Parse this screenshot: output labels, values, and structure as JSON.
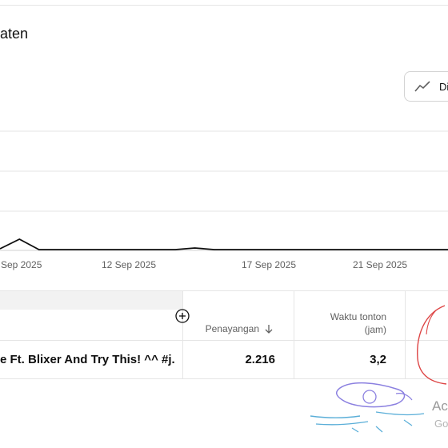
{
  "page": {
    "title": "aten"
  },
  "chart_toggle": {
    "label": "Di",
    "icon": "line-chart-icon"
  },
  "chart_data": {
    "type": "line",
    "x_tick_labels": [
      "Sep 2025",
      "12 Sep 2025",
      "17 Sep 2025",
      "21 Sep 2025"
    ],
    "series": [
      {
        "values": [
          2,
          14,
          1,
          1,
          1,
          1,
          1,
          1,
          1,
          1,
          3,
          1,
          1,
          1,
          1,
          1,
          1,
          1,
          1,
          1,
          1,
          1,
          1,
          1
        ]
      }
    ],
    "grid": true,
    "line_color": "#0f0f0f"
  },
  "table": {
    "add_column_icon": "plus-circle-icon",
    "columns": [
      {
        "label": "Penayangan",
        "sort_icon": "arrow-down-icon"
      },
      {
        "label_line1": "Waktu tonton",
        "label_line2": "(jam)"
      }
    ],
    "rows": [
      {
        "title": "e Ft. Blixer And Try This! ^^ #j...",
        "views": "2.216",
        "watch_time": "3,2"
      }
    ]
  },
  "overlay": {
    "text": "Ac",
    "subtext": "Go"
  }
}
